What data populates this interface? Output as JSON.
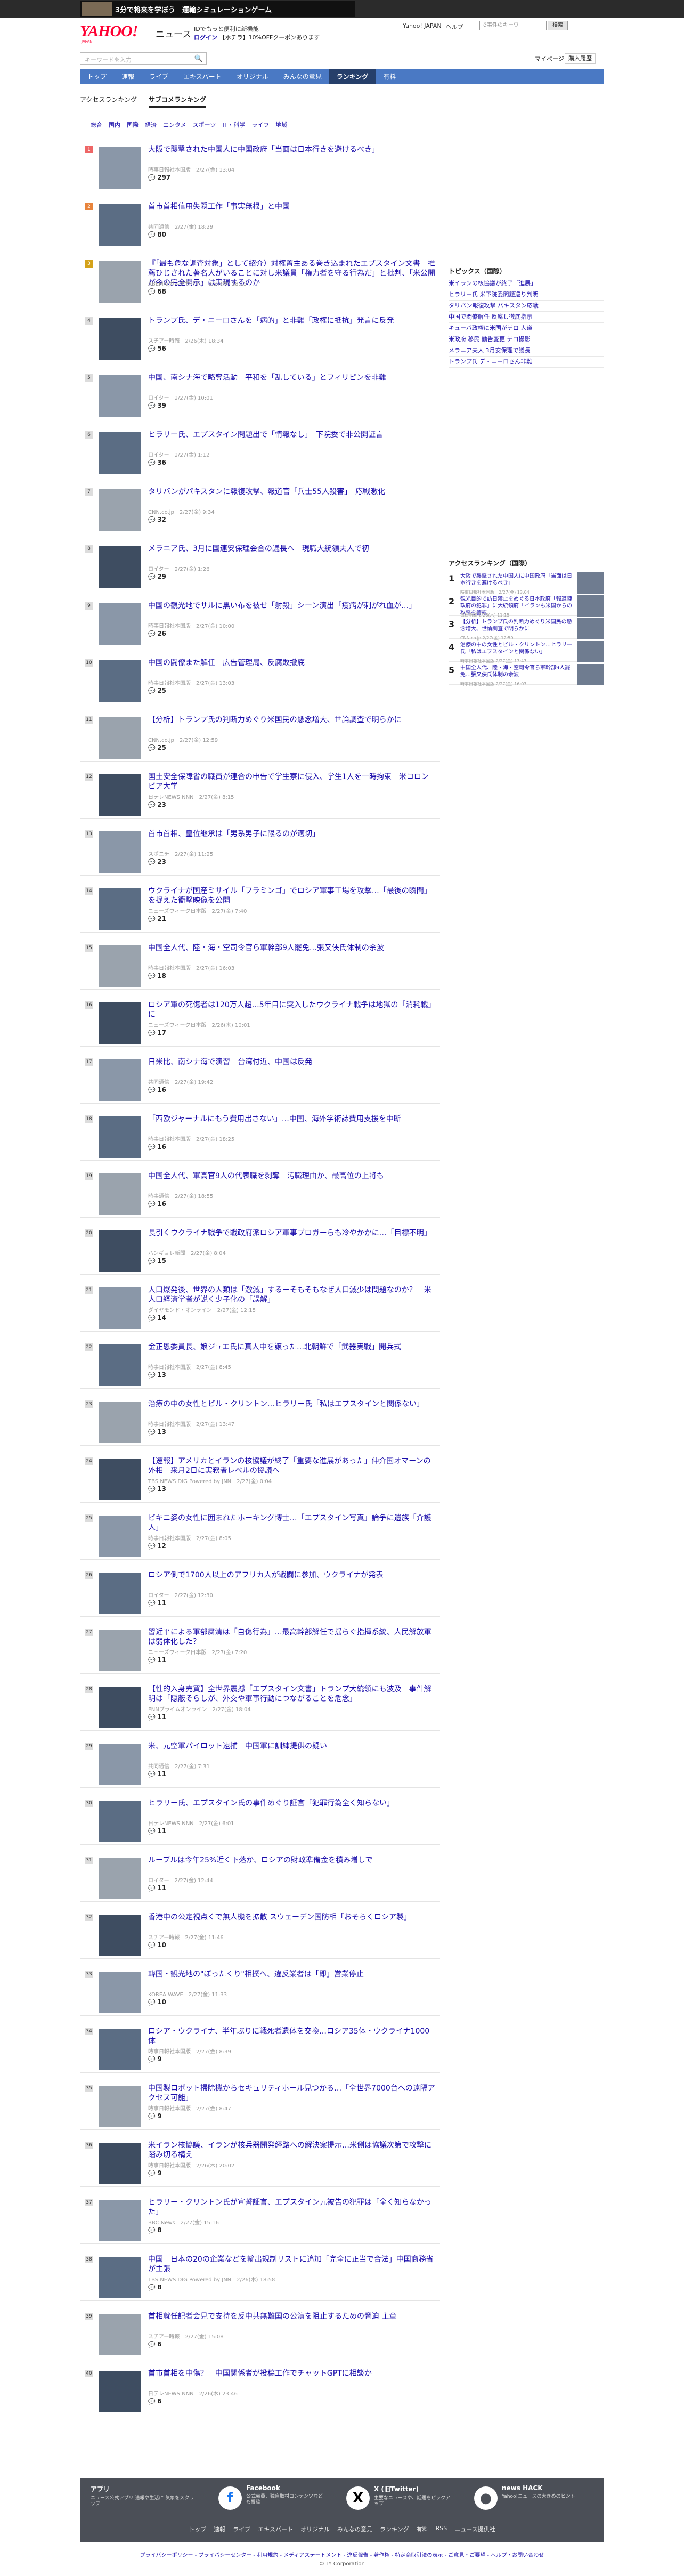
{
  "banner": {
    "text": "3分で将来を学ぼう　運輸シミュレーションゲーム"
  },
  "header": {
    "logo": "YAHOO!",
    "logo_sub": "JAPAN",
    "news_label": "ニュース",
    "promo1": "IDでもっと便利に新機能",
    "login": "ログイン",
    "promo2_rest": "【ホチラ】10%OFFクーポンあります",
    "links": [
      "Yahoo! JAPAN",
      "ヘルプ"
    ],
    "search_placeholder": "で事件のキーワ",
    "search_button": "検索"
  },
  "searchrow": {
    "placeholder": "キーワードを入力",
    "mypage": "マイページ",
    "purchase": "購入履歴"
  },
  "nav": [
    {
      "label": "トップ"
    },
    {
      "label": "速報"
    },
    {
      "label": "ライブ"
    },
    {
      "label": "エキスパート"
    },
    {
      "label": "オリジナル"
    },
    {
      "label": "みんなの意見"
    },
    {
      "label": "ランキング"
    },
    {
      "label": "有料"
    }
  ],
  "subnav": [
    "アクセスランキング",
    "サブコメランキング"
  ],
  "categories": [
    "総合",
    "国内",
    "国際",
    "経済",
    "エンタメ",
    "スポーツ",
    "IT・科学",
    "ライフ",
    "地域"
  ],
  "articles": [
    {
      "rank": "1",
      "title": "大阪で襲撃された中国人に中国政府「当面は日本行きを避けるべき」",
      "meta": "時事日報社本国版　2/27(金) 13:04",
      "comments": "297"
    },
    {
      "rank": "2",
      "title": "首市首相信用失隠工作「事実無根」と中国",
      "meta": "共同通信　2/27(金) 18:29",
      "comments": "80"
    },
    {
      "rank": "3",
      "title": "『「最も危な調査対象」として紹介）対権置主ある巻き込まれたエプスタイン文書　推薦ひじされた著名人がいることに対し米議員「権力者を守る行為だ」と批判、「米公開が今の完全開示」は実現するのか",
      "meta": "ABEMA(ガネナサイド)　2/27(金) 18:15",
      "comments": "68"
    },
    {
      "rank": "4",
      "title": "トランプ氏、デ・ニーロさんを「病的」と非難「政権に抵抗」発言に反発",
      "meta": "スチアー時報　2/26(木) 18:34",
      "comments": "56"
    },
    {
      "rank": "5",
      "title": "中国、南シナ海で略奪活動　平和を「乱している」とフィリピンを非難",
      "meta": "ロイター　2/27(金) 10:01",
      "comments": "39"
    },
    {
      "rank": "6",
      "title": "ヒラリー氏、エプスタイン問題出で「情報なし」　下院委で非公開証言",
      "meta": "ロイター　2/27(金) 1:12",
      "comments": "36"
    },
    {
      "rank": "7",
      "title": "タリバンがパキスタンに報復攻撃、報道官「兵士55人殺害」　応戦激化",
      "meta": "CNN.co.jp　2/27(金) 9:34",
      "comments": "32"
    },
    {
      "rank": "8",
      "title": "メラニア氏、3月に国連安保理会合の議長へ　現職大統領夫人で初",
      "meta": "ロイター　2/27(金) 1:26",
      "comments": "29"
    },
    {
      "rank": "9",
      "title": "中国の観光地でサルに黒い布を被せ「射殺」シーン演出「疫病が刺がれ血が…」",
      "meta": "時事日報社本国版　2/27(金) 10:00",
      "comments": "26"
    },
    {
      "rank": "10",
      "title": "中国の闘僚また解任　広告管理局、反腐敗撤底",
      "meta": "時事日報社本国版　2/27(金) 13:03",
      "comments": "25"
    },
    {
      "rank": "11",
      "title": "【分析】トランプ氏の判断力めぐり米国民の懸念増大、世論調査で明らかに",
      "meta": "CNN.co.jp　2/27(金) 12:59",
      "comments": "25"
    },
    {
      "rank": "12",
      "title": "国土安全保障省の職員が連合の申告で学生寮に侵入、学生1人を一時拘束　米コロンビア大学",
      "meta": "日テレNEWS NNN　2/27(金) 8:15",
      "comments": "23"
    },
    {
      "rank": "13",
      "title": "首市首相、皇位継承は「男系男子に限るのが適切」",
      "meta": "スポニチ　2/27(金) 11:25",
      "comments": "23"
    },
    {
      "rank": "14",
      "title": "ウクライナが国産ミサイル「フラミンゴ」でロシア軍事工場を攻撃…「最後の瞬間」を捉えた衝撃映像を公開",
      "meta": "ニューズウィーク日本版　2/27(金) 7:40",
      "comments": "21"
    },
    {
      "rank": "15",
      "title": "中国全人代、陸・海・空司令官ら軍幹部9人罷免…張又侠氏体制の余波",
      "meta": "時事日報社本国版　2/27(金) 16:03",
      "comments": "18"
    },
    {
      "rank": "16",
      "title": "ロシア軍の死傷者は120万人超…5年目に突入したウクライナ戦争は地獄の「消耗戦」に",
      "meta": "ニューズウィーク日本版　2/26(木) 10:01",
      "comments": "17"
    },
    {
      "rank": "17",
      "title": "日米比、南シナ海で演習　台湾付近、中国は反発",
      "meta": "共同通信　2/27(金) 19:42",
      "comments": "16"
    },
    {
      "rank": "18",
      "title": "「西欧ジャーナルにもう費用出さない」…中国、海外学術誌費用支援を中断",
      "meta": "時事日報社本国版　2/27(金) 18:25",
      "comments": "16"
    },
    {
      "rank": "19",
      "title": "中国全人代、軍高官9人の代表職を剥奪　汚職理由か、最高位の上将も",
      "meta": "時事通信　2/27(金) 18:55",
      "comments": "16"
    },
    {
      "rank": "20",
      "title": "長引くウクライナ戦争で戦政府派ロシア軍事ブロガーらも冷やかかに…「目標不明」",
      "meta": "ハンギョレ新聞　2/27(金) 8:04",
      "comments": "15"
    },
    {
      "rank": "21",
      "title": "人口爆発後、世界の人類は「激減」するーそもそもなぜ人口減少は問題なのか？　米人口経済学者が説く少子化の「誤解」",
      "meta": "ダイヤモンド・オンライン　2/27(金) 12:15",
      "comments": "14"
    },
    {
      "rank": "22",
      "title": "金正恩委員長、娘ジュエ氏に真人中を譲った…北朝鮮で「武器実戦」開兵式",
      "meta": "時事日報社本国版　2/27(金) 8:45",
      "comments": "13"
    },
    {
      "rank": "23",
      "title": "治療の中の女性とビル・クリントン…ヒラリー氏「私はエプスタインと関係ない」",
      "meta": "時事日報社本国版　2/27(金) 13:47",
      "comments": "13"
    },
    {
      "rank": "24",
      "title": "【速報】アメリカとイランの核協議が終了「重要な進展があった」仲介国オマーンの外相　来月2日に実務者レベルの協議へ",
      "meta": "TBS NEWS DIG Powered by JNN　2/27(金) 0:04",
      "comments": "13"
    },
    {
      "rank": "25",
      "title": "ビキニ姿の女性に囲まれたホーキング博士…「エプスタイン写真」論争に遺族「介護人」",
      "meta": "時事日報社本国版　2/27(金) 8:05",
      "comments": "12"
    },
    {
      "rank": "26",
      "title": "ロシア側で1700人以上のアフリカ人が戦闘に参加、ウクライナが発表",
      "meta": "ロイター　2/27(金) 12:30",
      "comments": "11"
    },
    {
      "rank": "27",
      "title": "習近平による軍部粛清は「自傷行為」…最高幹部解任で揺らぐ指揮系統、人民解放軍は弱体化した？",
      "meta": "ニューズウィーク日本版　2/27(金) 7:20",
      "comments": "11"
    },
    {
      "rank": "28",
      "title": "【性的入身売買】全世界震撼「エプスタイン文書」トランプ大統領にも波及　事件解明は「隠蔽そらしが、外交や軍事行動につながることを危念」",
      "meta": "FNNプライムオンライン　2/27(金) 18:04",
      "comments": "11"
    },
    {
      "rank": "29",
      "title": "米、元空軍パイロット逮捕　中国軍に訓練提供の疑い",
      "meta": "共同通信　2/27(金) 7:31",
      "comments": "11"
    },
    {
      "rank": "30",
      "title": "ヒラリー氏、エプスタイン氏の事件めぐり証言「犯罪行為全く知らない」",
      "meta": "日テレNEWS NNN　2/27(金) 6:01",
      "comments": "11"
    },
    {
      "rank": "31",
      "title": "ルーブルは今年25%近く下落か、ロシアの財政準備金を積み増しで",
      "meta": "ロイター　2/27(金) 12:44",
      "comments": "11"
    },
    {
      "rank": "32",
      "title": "香港中の公定視点くで無人機を拡散 スウェーデン国防相「おそらくロシア製」",
      "meta": "スチアー時報　2/27(金) 11:46",
      "comments": "10"
    },
    {
      "rank": "33",
      "title": "韓国・観光地の\"ぼったくり\"相撲へ、違反業者は「即」営業停止",
      "meta": "KOREA WAVE　2/27(金) 11:33",
      "comments": "10"
    },
    {
      "rank": "34",
      "title": "ロシア・ウクライナ、半年ぶりに戦死者遺体を交換…ロシア35体・ウクライナ1000体",
      "meta": "時事日報社本国版　2/27(金) 8:39",
      "comments": "9"
    },
    {
      "rank": "35",
      "title": "中国製ロボット掃除機からセキュリティホール見つかる…「全世界7000台への遠隔アクセス可能」",
      "meta": "時事日報社本国版　2/27(金) 8:47",
      "comments": "9"
    },
    {
      "rank": "36",
      "title": "米イラン核協議、イランが核兵器開発経路への解決案提示…米側は協議次第で攻撃に踏み切る構え",
      "meta": "時事日報社本国版　2/26(木) 20:02",
      "comments": "9"
    },
    {
      "rank": "37",
      "title": "ヒラリー・クリントン氏が宣誓証言、エプスタイン元被告の犯罪は「全く知らなかった」",
      "meta": "BBC News　2/27(金) 15:16",
      "comments": "8"
    },
    {
      "rank": "38",
      "title": "中国　日本の20の企業などを輸出規制リストに追加「完全に正当で合法」中国商務省が主張",
      "meta": "TBS NEWS DIG Powered by JNN　2/26(木) 18:58",
      "comments": "8"
    },
    {
      "rank": "39",
      "title": "首相就任記者会見で支持を反中共無難国の公演を阻止するための脅迫 主章",
      "meta": "スチアー時報　2/27(金) 15:08",
      "comments": "6"
    },
    {
      "rank": "40",
      "title": "首市首相を中傷？　中国関係者が投稿工作でチャットGPTに相談か",
      "meta": "日テレNEWS NNN　2/26(木) 23:46",
      "comments": "6"
    }
  ],
  "sidebar": {
    "topics_title": "トピックス（国際）",
    "topics": [
      "米イランの核協議が終了「進展」",
      "ヒラリー氏 米下院委問題巡り判明",
      "タリバン報復攻撃 パキスタン応戦",
      "中国で闘僚解任 反腐し徹底指示",
      "キューバ政権に米国がテロ 人道",
      "米政府 移民 勧告変更 テロ撮影",
      "メラニア夫人 3月安保理で議長",
      "トランプ氏 デ・ニーロさん非難"
    ],
    "access_title": "アクセスランキング（国際）",
    "access": [
      {
        "n": "1",
        "title": "大阪で襲撃された中国人に中国政府「当面は日本行きを避けるべき」",
        "meta": "時事日報社本国版　2/27(金) 13:04"
      },
      {
        "n": "2",
        "title": "観光目的で訪日禁止をめぐる日本政府「報道陣政府の犯罪」に大統領府「イランも米国からの攻撃を警戒",
        "meta": "毎日新聞 2/26(木) 11:15"
      },
      {
        "n": "3",
        "title": "【分析】トランプ氏の判断力めぐり米国民の懸念増大、世論調査で明らかに",
        "meta": "CNN.co.jp 2/27(金) 12:59"
      },
      {
        "n": "4",
        "title": "治療の中の女性とビル・クリントン…ヒラリー氏「私はエプスタインと関係ない」",
        "meta": "時事日報社本国版 2/27(金) 13:47"
      },
      {
        "n": "5",
        "title": "中国全人代、陸・海・空司令官ら軍幹部9人罷免…張又侠氏体制の余波",
        "meta": "時事日報社本国版 2/27(金) 16:03"
      }
    ]
  },
  "footer": {
    "app_title": "アプリ",
    "app_desc": "ニュース公式アプリ 速報や生活に 気象をスクラップ",
    "fb_title": "Facebook",
    "fb_desc": "公式会員、独自取材コンテンツなども投稿",
    "x_title": "X (旧Twitter)",
    "x_desc": "主要なニュースや、話題をピックアップ",
    "hack_title": "news HACK",
    "hack_desc": "Yahoo!ニュースの大きめのヒント",
    "nav": [
      "トップ",
      "速報",
      "ライブ",
      "エキスパート",
      "オリジナル",
      "みんなの意見",
      "ランキング",
      "有料",
      "RSS",
      "ニュース提供社"
    ],
    "policy": "プライバシーポリシー - プライバシーセンター - 利用規約 - メディアステートメント - 違反報告 - 著作権 - 特定商取引法の表示 - ご意見・ご要望 - ヘルプ・お問い合わせ",
    "copyright": "© LY Corporation"
  }
}
